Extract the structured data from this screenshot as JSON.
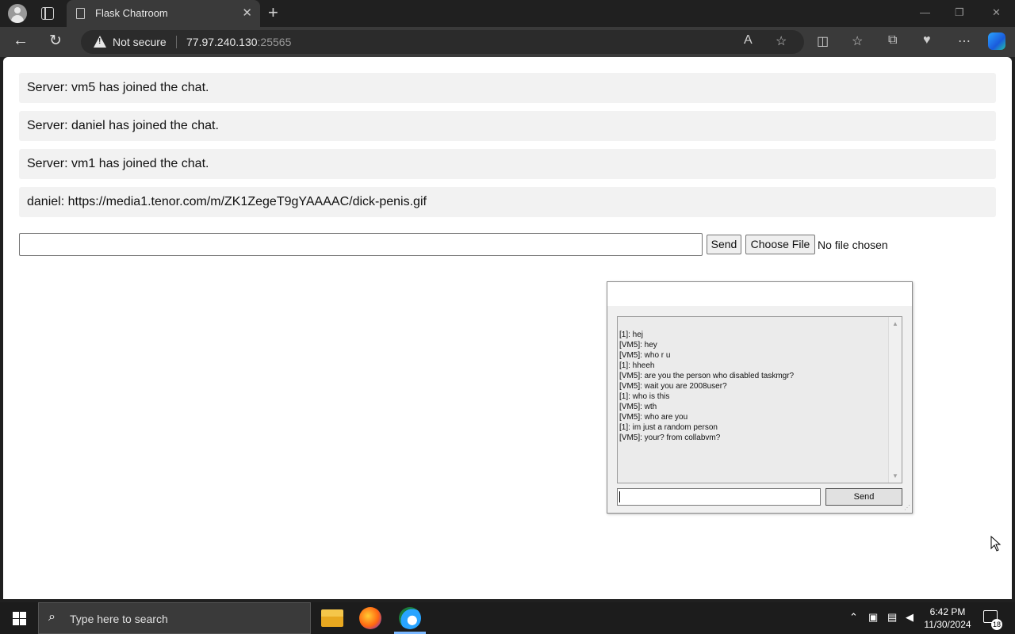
{
  "browser": {
    "tab_title": "Flask Chatroom",
    "tab_close": "✕",
    "new_tab": "+",
    "security_label": "Not secure",
    "url_host": "77.97.240.130",
    "url_port": ":25565",
    "window_controls": {
      "minimize": "—",
      "restore": "❐",
      "close": "✕"
    }
  },
  "chat": {
    "messages": [
      {
        "text": "Server: vm5 has joined the chat."
      },
      {
        "text": "Server: daniel has joined the chat."
      },
      {
        "text": "Server: vm1 has joined the chat."
      },
      {
        "text": "daniel: https://media1.tenor.com/m/ZK1ZegeT9gYAAAAC/dick-penis.gif"
      }
    ],
    "input_value": "",
    "send_label": "Send",
    "choose_file_label": "Choose File",
    "file_status": "No file chosen"
  },
  "popup": {
    "lines": [
      "[1]: hej",
      "[VM5]: hey",
      "[VM5]: who r u",
      "[1]: hheeh",
      "[VM5]: are you the person who disabled taskmgr?",
      "[VM5]: wait you are 2008user?",
      "[1]: who is this",
      "[VM5]: wth",
      "[VM5]: who are you",
      "[1]: im just a random person",
      "[VM5]: your? from collabvm?"
    ],
    "input_value": "",
    "send_label": "Send"
  },
  "taskbar": {
    "search_placeholder": "Type here to search",
    "time": "6:42 PM",
    "date": "11/30/2024",
    "notification_count": "18"
  }
}
